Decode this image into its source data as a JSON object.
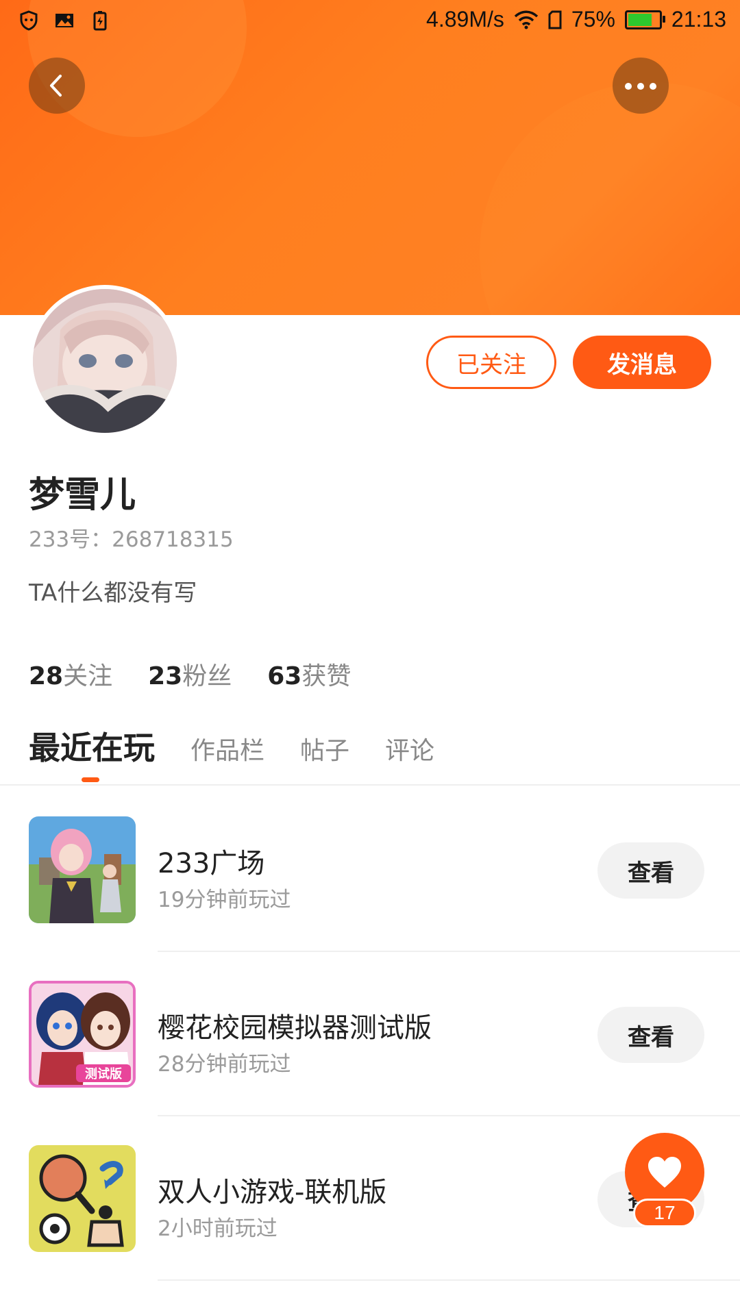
{
  "status_bar": {
    "speed": "4.89M/s",
    "battery_percent": "75%",
    "time": "21:13",
    "icons": [
      "shield-icon",
      "image-icon",
      "battery-saver-icon",
      "wifi-icon",
      "sim-icon",
      "battery-icon"
    ]
  },
  "header": {
    "back_icon": "chevron-left-icon",
    "more_icon": "more-dots-icon",
    "banner_color": "#ff7a1d"
  },
  "profile": {
    "follow_label": "已关注",
    "message_label": "发消息",
    "name": "梦雪儿",
    "id_text": "233号：268718315",
    "bio": "TA什么都没有写",
    "stats": [
      {
        "value": "28",
        "label": "关注"
      },
      {
        "value": "23",
        "label": "粉丝"
      },
      {
        "value": "63",
        "label": "获赞"
      }
    ]
  },
  "tabs": [
    {
      "label": "最近在玩",
      "active": true
    },
    {
      "label": "作品栏",
      "active": false
    },
    {
      "label": "帖子",
      "active": false
    },
    {
      "label": "评论",
      "active": false
    }
  ],
  "games": [
    {
      "name": "233广场",
      "played": "19分钟前玩过",
      "action": "查看"
    },
    {
      "name": "樱花校园模拟器测试版",
      "played": "28分钟前玩过",
      "action": "查看"
    },
    {
      "name": "双人小游戏-联机版",
      "played": "2小时前玩过",
      "action": "查看"
    }
  ],
  "like": {
    "count": "17",
    "icon": "heart-icon"
  },
  "colors": {
    "accent": "#ff5a14",
    "text_primary": "#222222",
    "text_secondary": "#9a9a9a"
  }
}
